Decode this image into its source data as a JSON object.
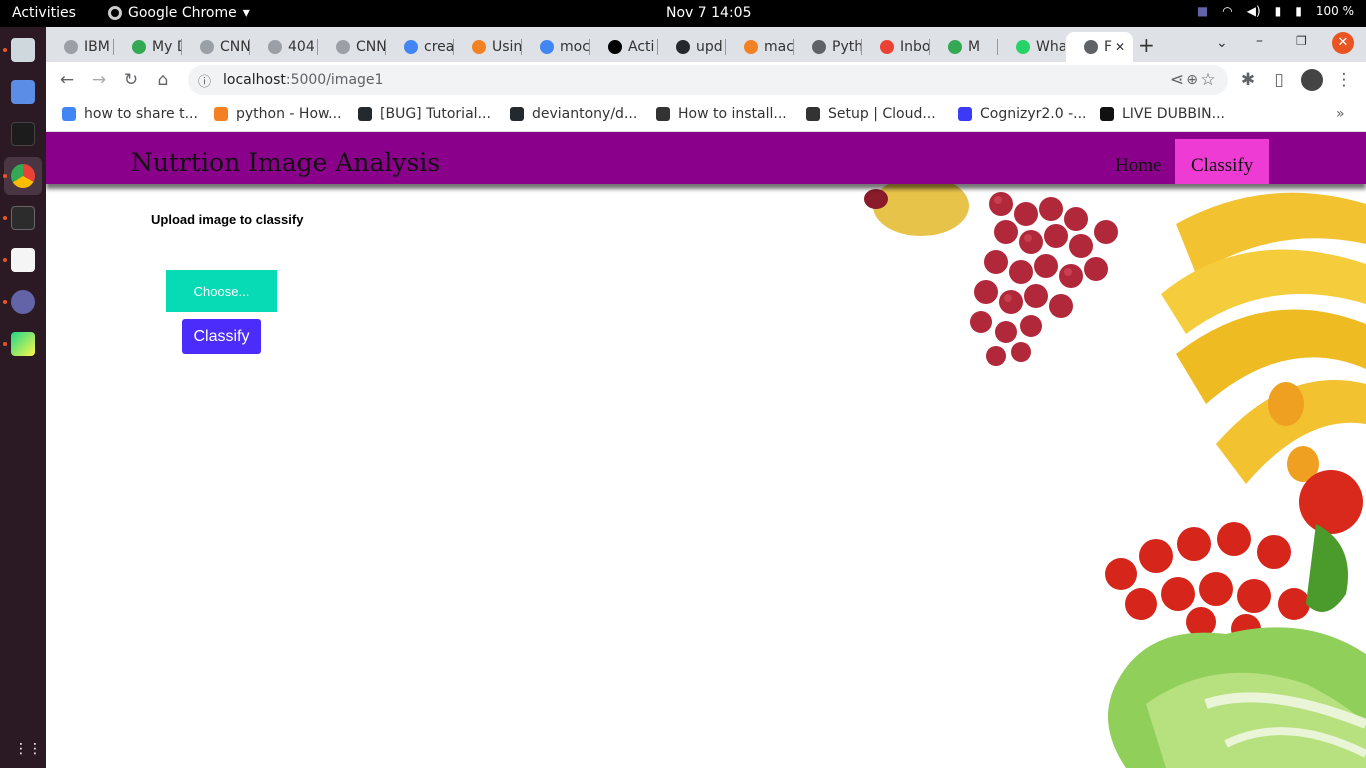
{
  "system": {
    "activities": "Activities",
    "app_name": "Google Chrome",
    "clock": "Nov 7  14:05",
    "battery": "100 %"
  },
  "browser": {
    "tabs": [
      {
        "label": "IBM",
        "color": "#9aa0a6"
      },
      {
        "label": "My D",
        "color": "#34a853"
      },
      {
        "label": "CNN",
        "color": "#9aa0a6"
      },
      {
        "label": "404",
        "color": "#9aa0a6"
      },
      {
        "label": "CNN",
        "color": "#9aa0a6"
      },
      {
        "label": "crea",
        "color": "#4285f4"
      },
      {
        "label": "Usin",
        "color": "#f48024"
      },
      {
        "label": "moc",
        "color": "#4285f4"
      },
      {
        "label": "Acti",
        "color": "#000000"
      },
      {
        "label": "upd",
        "color": "#24292e"
      },
      {
        "label": "mac",
        "color": "#f48024"
      },
      {
        "label": "Pyth",
        "color": "#5f6368"
      },
      {
        "label": "Inbo",
        "color": "#ea4335"
      },
      {
        "label": "M",
        "color": "#34a853"
      },
      {
        "label": "Wha",
        "color": "#25d366"
      },
      {
        "label": "F",
        "color": "#5f6368"
      }
    ],
    "url_host": "localhost",
    "url_path": ":5000/image1",
    "bookmarks": [
      {
        "label": "how to share t...",
        "color": "#4285f4"
      },
      {
        "label": "python - How...",
        "color": "#f48024"
      },
      {
        "label": "[BUG] Tutorial...",
        "color": "#24292e"
      },
      {
        "label": "deviantony/d...",
        "color": "#24292e"
      },
      {
        "label": "How to install...",
        "color": "#333333"
      },
      {
        "label": "Setup | Cloud...",
        "color": "#333333"
      },
      {
        "label": "Cognizyr2.0 -...",
        "color": "#3b3bf5"
      },
      {
        "label": "LIVE DUBBIN...",
        "color": "#111111"
      }
    ]
  },
  "app": {
    "brand": "Nutrtion Image Analysis",
    "nav_home": "Home",
    "nav_classify": "Classify",
    "upload_label": "Upload image to classify",
    "choose_label": "Choose...",
    "classify_button": "Classify",
    "colors": {
      "navbar": "#8b008b",
      "active_nav": "#ee3bd4",
      "choose": "#06dbb5",
      "classify": "#4c2cfb"
    }
  }
}
